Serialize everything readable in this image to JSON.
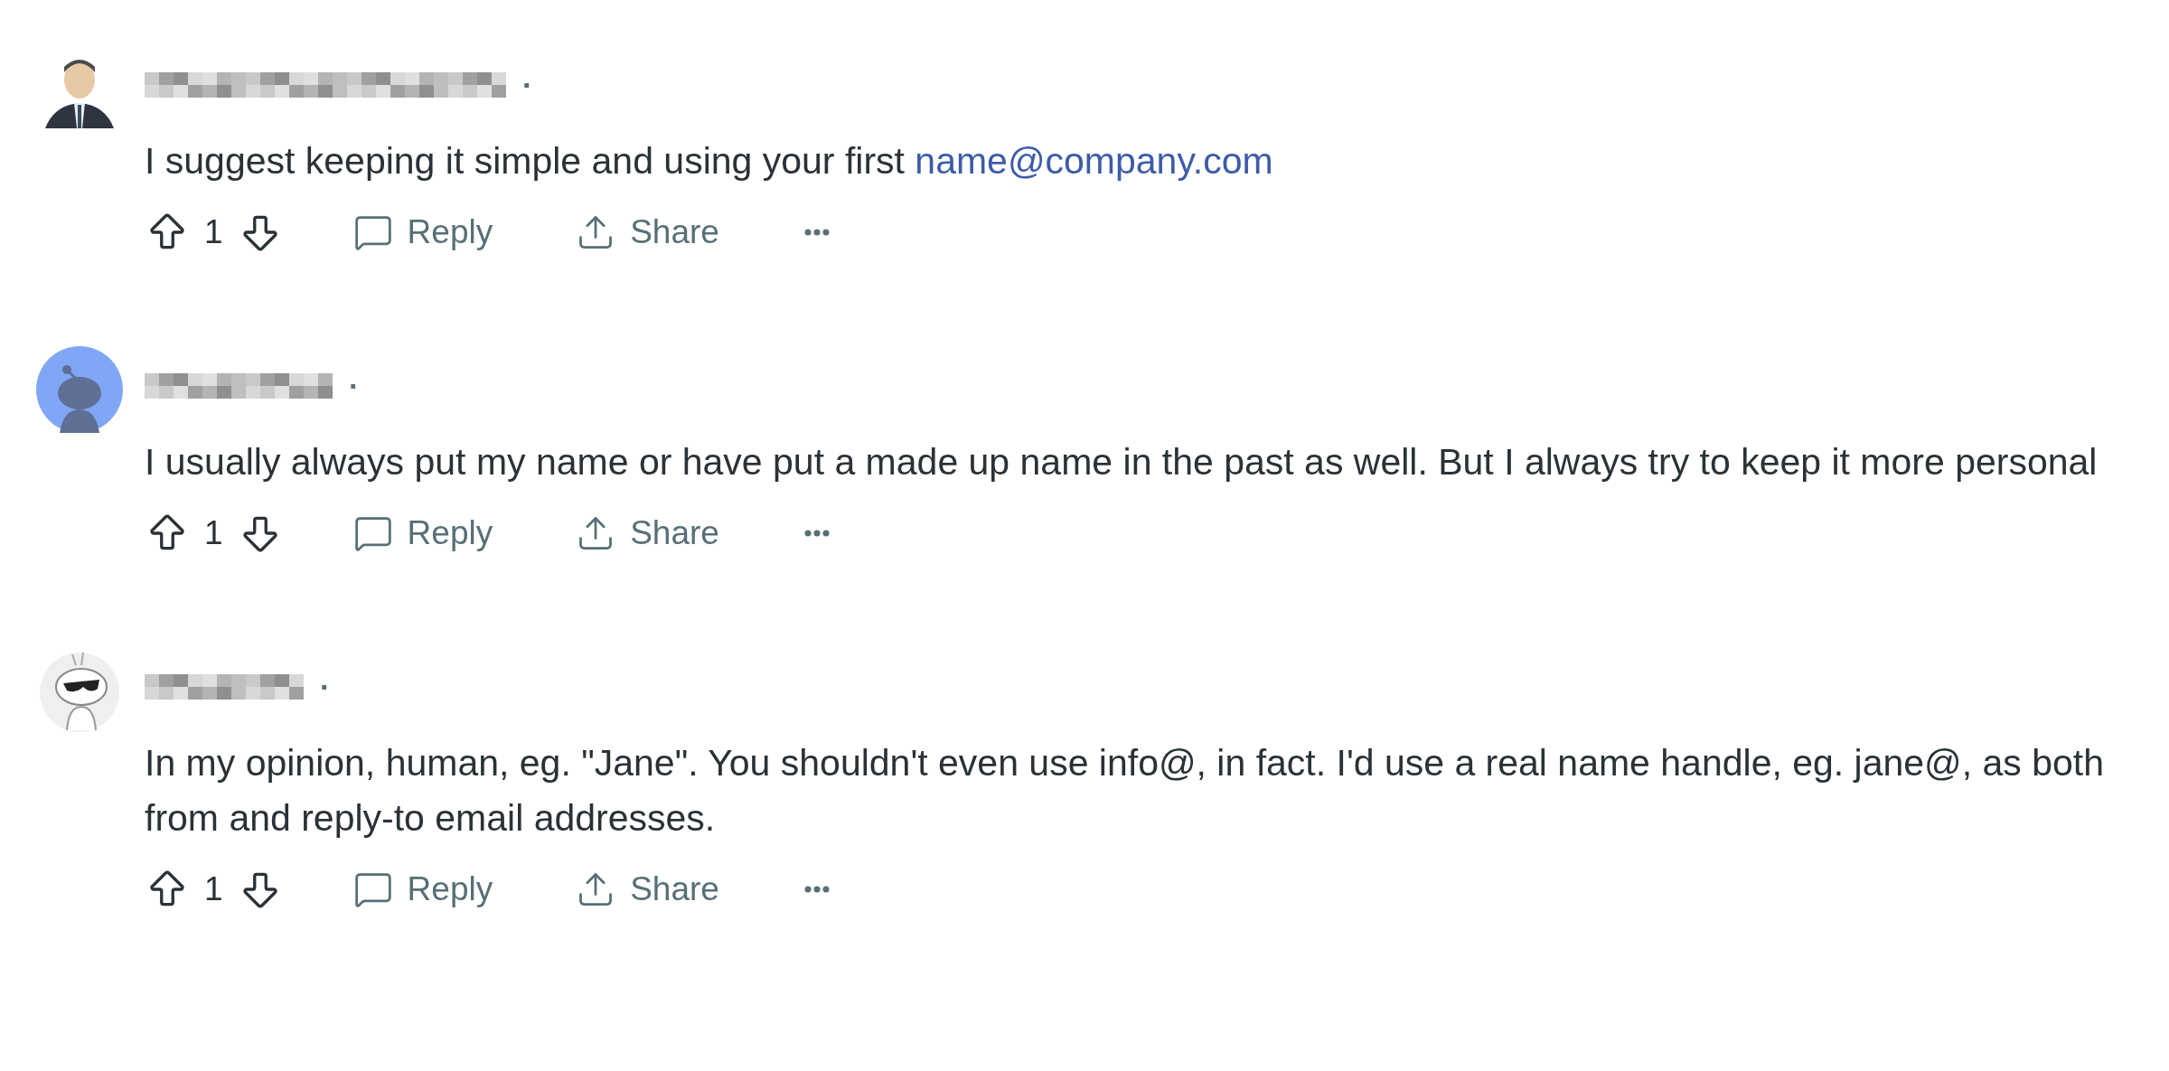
{
  "comments": [
    {
      "avatar": {
        "kind": "person"
      },
      "separator": "·",
      "body": "I suggest keeping it simple and using your first",
      "link": "name@company.com",
      "votes": "1",
      "actions": [
        "Reply",
        "Share"
      ]
    },
    {
      "avatar": {
        "kind": "snoo"
      },
      "separator": "·",
      "body": "I usually always put my name or have put a made up name in the past as well. But I always try to keep it more personal",
      "votes": "1",
      "actions": [
        "Reply",
        "Share"
      ]
    },
    {
      "avatar": {
        "kind": "snoo-shades"
      },
      "separator": "·",
      "body": "In my opinion, human, eg. \"Jane\". You shouldn't even use info@, in fact. I'd use a real name handle, eg. jane@, as both from and reply-to email addresses.",
      "votes": "1",
      "actions": [
        "Reply",
        "Share"
      ]
    }
  ]
}
